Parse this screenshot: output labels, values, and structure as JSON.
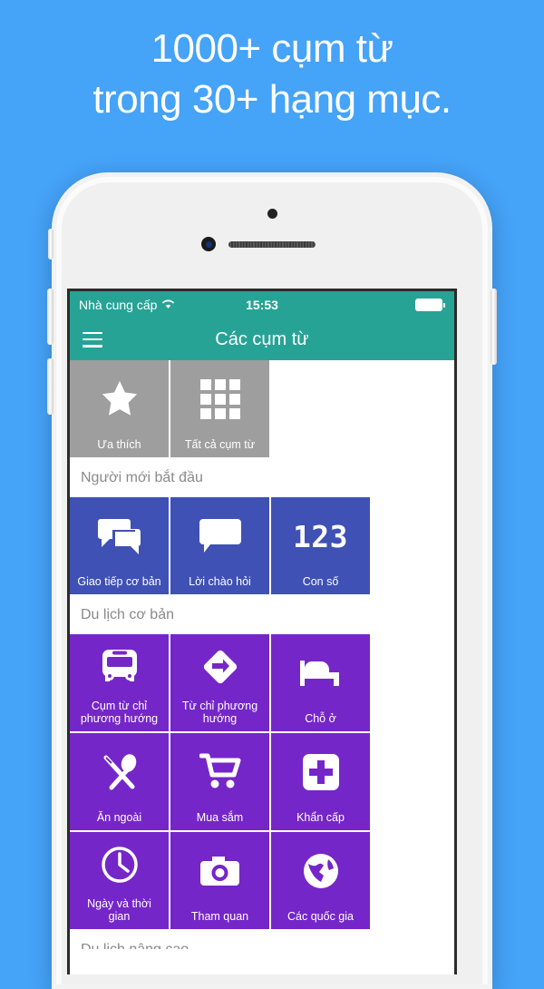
{
  "headline": {
    "line1": "1000+ cụm từ",
    "line2": "trong 30+ hạng mục."
  },
  "colors": {
    "background": "#45a3f8",
    "nav_teal": "#27a396",
    "tile_gray": "#9e9e9e",
    "tile_blue": "#3f51b5",
    "tile_purple": "#7526c8",
    "section_text": "#8a8a8a"
  },
  "status_bar": {
    "carrier": "Nhà cung cấp",
    "wifi_icon": "wifi-icon",
    "time": "15:53",
    "battery_icon": "battery-full-icon"
  },
  "nav_bar": {
    "menu_icon": "hamburger-menu-icon",
    "title": "Các cụm từ"
  },
  "quick_tiles": [
    {
      "label": "Ưa thích",
      "icon": "star-icon",
      "color": "gray"
    },
    {
      "label": "Tất cả cụm từ",
      "icon": "grid-3x3-icon",
      "color": "gray"
    }
  ],
  "sections": [
    {
      "title": "Người mới bắt đầu",
      "color": "blue",
      "tiles": [
        {
          "label": "Giao tiếp cơ bản",
          "icon": "chat-bubbles-icon"
        },
        {
          "label": "Lời chào hỏi",
          "icon": "speech-bubble-icon"
        },
        {
          "label": "Con số",
          "icon": "numbers-123-icon",
          "glyph": "123"
        }
      ]
    },
    {
      "title": "Du lịch cơ bản",
      "color": "purple",
      "tiles": [
        {
          "label": "Cụm từ chỉ phương hướng",
          "icon": "bus-icon"
        },
        {
          "label": "Từ chỉ phương hướng",
          "icon": "direction-sign-icon"
        },
        {
          "label": "Chỗ ở",
          "icon": "bed-icon"
        },
        {
          "label": "Ăn ngoài",
          "icon": "fork-spoon-icon"
        },
        {
          "label": "Mua sắm",
          "icon": "shopping-cart-icon"
        },
        {
          "label": "Khẩn cấp",
          "icon": "plus-cross-icon"
        },
        {
          "label": "Ngày và thời gian",
          "icon": "clock-icon"
        },
        {
          "label": "Tham quan",
          "icon": "camera-icon"
        },
        {
          "label": "Các quốc gia",
          "icon": "globe-icon"
        }
      ]
    }
  ],
  "clipped_section_title": "Du lịch nâng cao"
}
